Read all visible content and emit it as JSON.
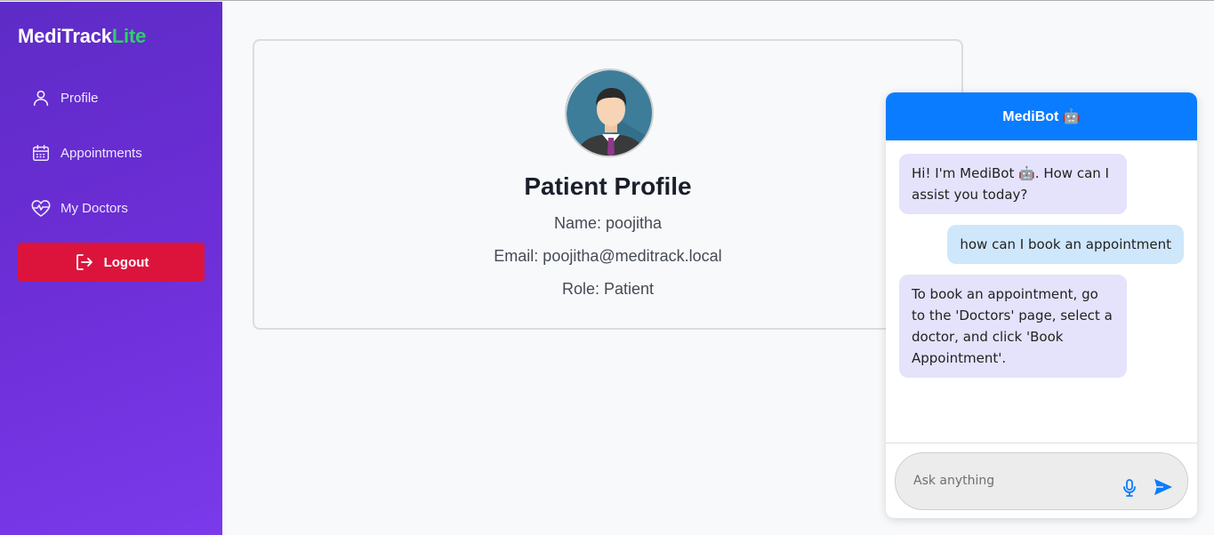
{
  "brand": {
    "name": "MediTrack",
    "suffix": "Lite",
    "suffix_color": "#2fcf6a"
  },
  "sidebar": {
    "items": [
      {
        "label": "Profile",
        "icon": "user-icon"
      },
      {
        "label": "Appointments",
        "icon": "calendar-icon"
      },
      {
        "label": "My Doctors",
        "icon": "heart-pulse-icon"
      }
    ],
    "logout_label": "Logout"
  },
  "profile": {
    "title": "Patient Profile",
    "name_line": "Name: poojitha",
    "email_line": "Email: poojitha@meditrack.local",
    "role_line": "Role: Patient"
  },
  "chat": {
    "title": "MediBot 🤖",
    "messages": [
      {
        "sender": "bot",
        "text": "Hi! I'm MediBot 🤖. How can I assist you today?"
      },
      {
        "sender": "user",
        "text": "how can I book an appointment"
      },
      {
        "sender": "bot",
        "text": "To book an appointment, go to the 'Doctors' page, select a doctor, and click 'Book Appointment'."
      }
    ],
    "input_placeholder": "Ask anything"
  },
  "colors": {
    "sidebar_gradient": [
      "#5e2bc6",
      "#7b3aeb"
    ],
    "logout": "#dc143c",
    "chat_header": "#0a7cff",
    "bot_bubble": "#e4e3fb",
    "user_bubble": "#cfe7fb"
  }
}
